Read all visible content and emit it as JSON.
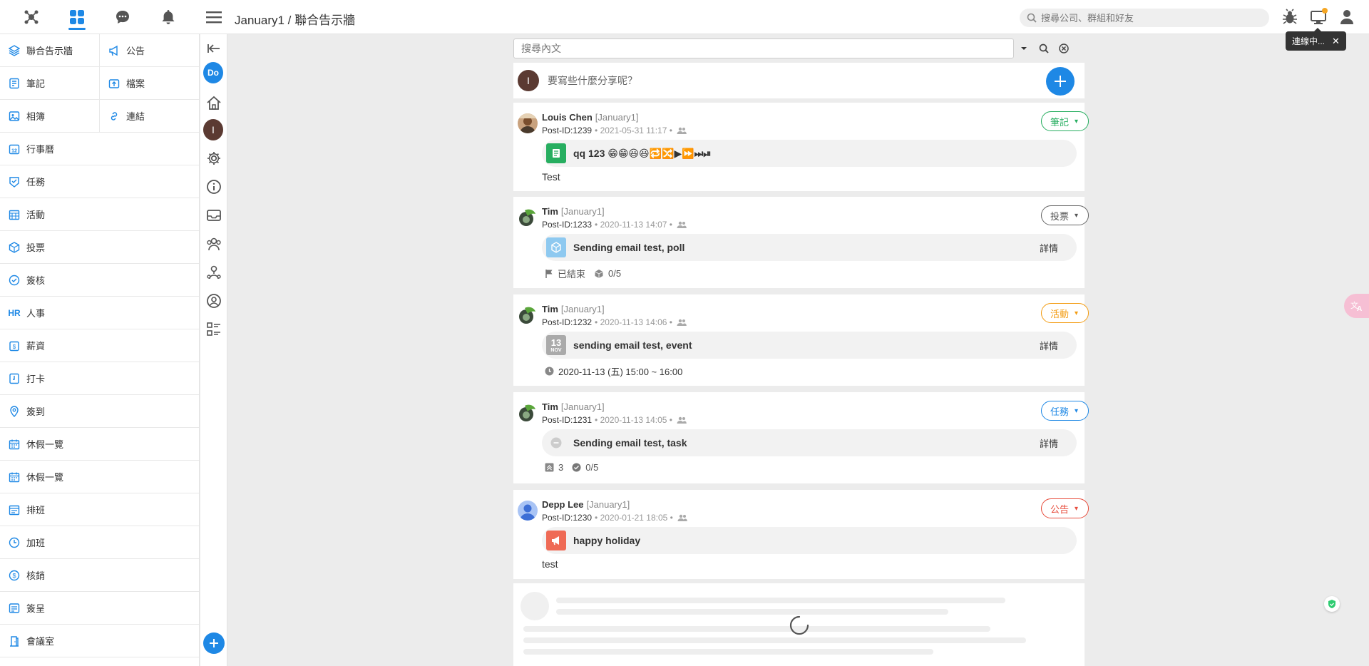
{
  "topbar": {
    "breadcrumb": "January1 / 聯合告示牆",
    "search_placeholder": "搜尋公司、群組和好友",
    "tooltip": "連線中..."
  },
  "menu": {
    "grid": [
      {
        "label": "聯合告示牆",
        "icon": "layers-icon"
      },
      {
        "label": "公告",
        "icon": "megaphone-icon"
      },
      {
        "label": "筆記",
        "icon": "note-icon"
      },
      {
        "label": "檔案",
        "icon": "upload-folder-icon"
      },
      {
        "label": "相簿",
        "icon": "image-icon"
      },
      {
        "label": "連結",
        "icon": "link-icon"
      }
    ],
    "list": [
      {
        "label": "行事曆",
        "icon": "calendar-icon"
      },
      {
        "label": "任務",
        "icon": "task-icon"
      },
      {
        "label": "活動",
        "icon": "event-icon"
      },
      {
        "label": "投票",
        "icon": "poll-icon"
      },
      {
        "label": "簽核",
        "icon": "approval-icon"
      },
      {
        "label": "人事",
        "icon": "hr-icon",
        "icon_text": "HR"
      },
      {
        "label": "薪資",
        "icon": "salary-icon"
      },
      {
        "label": "打卡",
        "icon": "punch-icon"
      },
      {
        "label": "簽到",
        "icon": "checkin-icon"
      },
      {
        "label": "休假一覽",
        "icon": "leave-icon"
      },
      {
        "label": "休假一覽",
        "icon": "leave-icon"
      },
      {
        "label": "排班",
        "icon": "schedule-icon"
      },
      {
        "label": "加班",
        "icon": "overtime-icon"
      },
      {
        "label": "核銷",
        "icon": "reimburse-icon"
      },
      {
        "label": "簽呈",
        "icon": "petition-icon"
      },
      {
        "label": "會議室",
        "icon": "meeting-room-icon"
      }
    ]
  },
  "rail": {
    "do_label": "Do",
    "user_initial": "I"
  },
  "feed": {
    "search_placeholder": "搜尋內文",
    "composer_initial": "I",
    "composer_prompt": "要寫些什麼分享呢？",
    "posts": [
      {
        "author": "Louis Chen",
        "group": "[January1]",
        "post_id": "Post-ID:1239",
        "date": "• 2021-05-31 11:17 •",
        "tag": "筆記",
        "card_title": "qq 123 😁😁😃😃🔁🔀▶⏩⏭⏯",
        "body": "Test"
      },
      {
        "author": "Tim",
        "group": "[January1]",
        "post_id": "Post-ID:1233",
        "date": "• 2020-11-13 14:07 •",
        "tag": "投票",
        "card_title": "Sending email test, poll",
        "detail": "詳情",
        "status": "已結束",
        "count": "0/5"
      },
      {
        "author": "Tim",
        "group": "[January1]",
        "post_id": "Post-ID:1232",
        "date": "• 2020-11-13 14:06 •",
        "tag": "活動",
        "card_title": "sending email test, event",
        "detail": "詳情",
        "cal_day": "13",
        "cal_month": "NOV",
        "time": "2020-11-13 (五) 15:00 ~ 16:00"
      },
      {
        "author": "Tim",
        "group": "[January1]",
        "post_id": "Post-ID:1231",
        "date": "• 2020-11-13 14:05 •",
        "tag": "任務",
        "card_title": "Sending email test, task",
        "detail": "詳情",
        "priority": "3",
        "count": "0/5"
      },
      {
        "author": "Depp Lee",
        "group": "[January1]",
        "post_id": "Post-ID:1230",
        "date": "• 2020-01-21 18:05 •",
        "tag": "公告",
        "card_title": "happy holiday",
        "body": "test"
      }
    ]
  },
  "colors": {
    "accent": "#1e88e5",
    "note_green": "#27ae60",
    "poll_gray": "#666666",
    "event_orange": "#f39c12",
    "task_blue": "#1e88e5",
    "announce_red": "#e74c3c"
  }
}
